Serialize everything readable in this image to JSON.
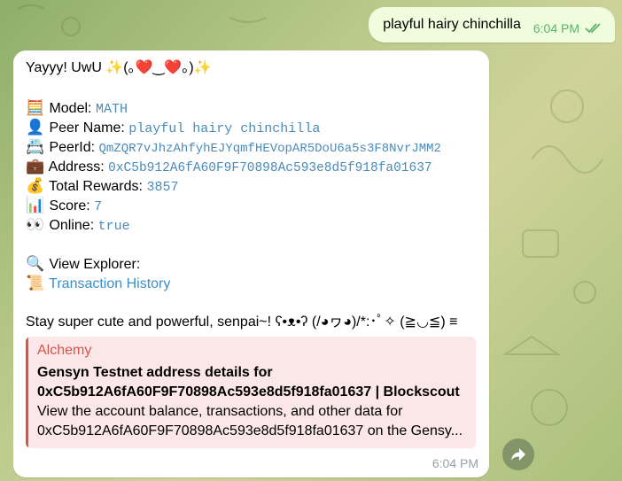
{
  "outgoing": {
    "text": "playful hairy chinchilla",
    "time": "6:04 PM",
    "status_icon": "double-check-icon"
  },
  "incoming": {
    "greeting": "Yayyy! UwU ✨(｡❤️‿❤️｡)✨",
    "fields": [
      {
        "icon": "🧮",
        "label": "Model:",
        "value": "MATH"
      },
      {
        "icon": "👤",
        "label": "Peer Name:",
        "value": "playful hairy chinchilla"
      },
      {
        "icon": "📇",
        "label": "PeerId:",
        "value": "QmZQR7vJhzAhfyhEJYqmfHEVopAR5DoU6a5s3F8NvrJMM2"
      },
      {
        "icon": "💼",
        "label": "Address:",
        "value": "0xC5b912A6fA60F9F70898Ac593e8d5f918fa01637"
      },
      {
        "icon": "💰",
        "label": "Total Rewards:",
        "value": "3857"
      },
      {
        "icon": "📊",
        "label": "Score:",
        "value": "7"
      },
      {
        "icon": "👀",
        "label": "Online:",
        "value": "true"
      }
    ],
    "explorer_icon": "🔍",
    "explorer_label": "View Explorer:",
    "history_icon": "📜",
    "history_link": "Transaction History",
    "closing": "Stay super cute and powerful, senpai~! ʕ•ᴥ•ʔ (/◕ヮ◕)/*:･ﾟ✧ (≧◡≦) ≡",
    "preview": {
      "site": "Alchemy",
      "title": "Gensyn Testnet address details for 0xC5b912A6fA60F9F70898Ac593e8d5f918fa01637 | Blockscout",
      "desc_line1": "View the account balance, transactions, and other data for",
      "desc_line2": "0xC5b912A6fA60F9F70898Ac593e8d5f918fa01637 on the Gensy..."
    },
    "time": "6:04 PM"
  }
}
